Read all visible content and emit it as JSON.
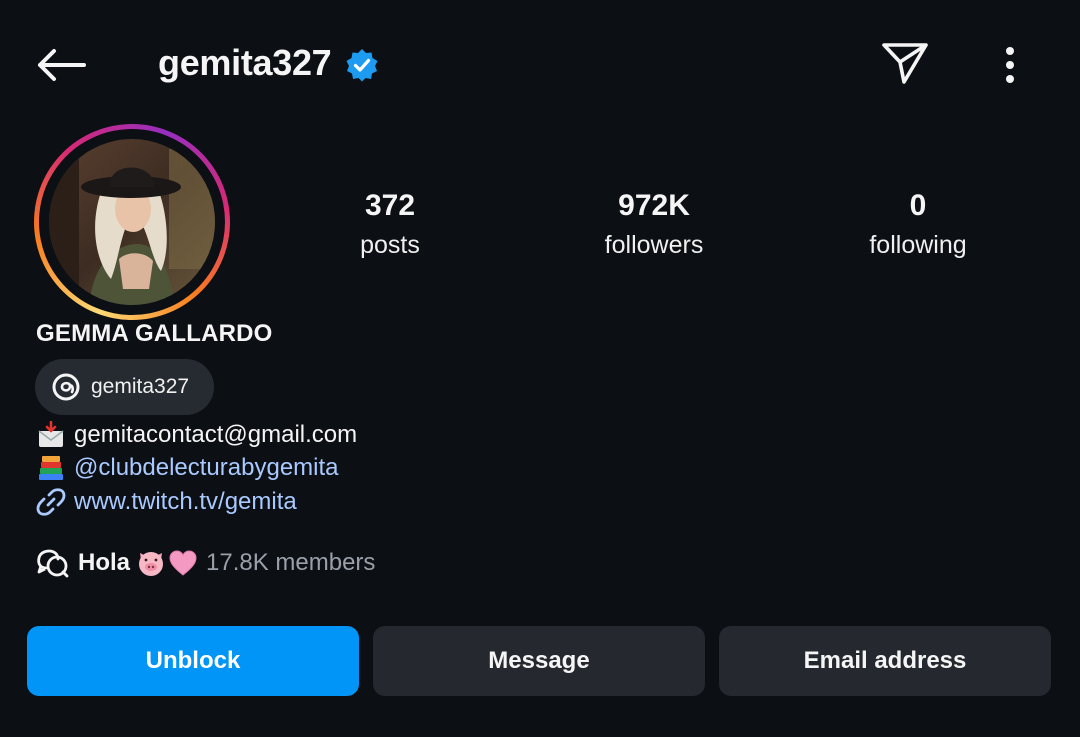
{
  "header": {
    "username": "gemita327",
    "verified": true,
    "icons": {
      "back": "back-arrow-icon",
      "send": "paper-plane-icon",
      "more": "more-vertical-icon",
      "verified": "verified-badge-icon"
    }
  },
  "profile": {
    "full_name": "GEMMA GALLARDO",
    "threads_handle": "gemita327",
    "stats": [
      {
        "value": "372",
        "label": "posts"
      },
      {
        "value": "972K",
        "label": "followers"
      },
      {
        "value": "0",
        "label": "following"
      }
    ]
  },
  "bio": {
    "email": "gemitacontact@gmail.com",
    "mention": "@clubdelecturabygemita",
    "link": "www.twitch.tv/gemita"
  },
  "channel": {
    "name": "Hola",
    "members": "17.8K members"
  },
  "actions": {
    "unblock": "Unblock",
    "message": "Message",
    "email": "Email address"
  },
  "colors": {
    "background": "#0c0f14",
    "accent": "#0095f6",
    "link": "#a9c9ff",
    "button_secondary": "#25282e"
  }
}
